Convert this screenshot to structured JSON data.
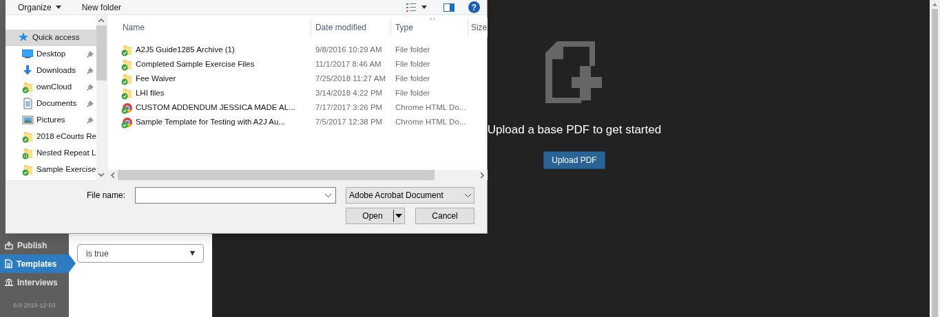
{
  "app": {
    "sidebar": {
      "items": [
        {
          "label": "Publish",
          "kind": "publish",
          "selected": false
        },
        {
          "label": "Templates",
          "kind": "document",
          "selected": true
        },
        {
          "label": "Interviews",
          "kind": "bank",
          "selected": false
        }
      ],
      "version": "6.0 2018-12-03"
    },
    "panel": {
      "select_value": "is true"
    },
    "main": {
      "message": "Upload a base PDF to get started",
      "button": "Upload PDF"
    }
  },
  "dialog": {
    "toolbar": {
      "organize": "Organize",
      "new_folder": "New folder",
      "help": "?"
    },
    "nav": [
      {
        "label": "Quick access",
        "kind": "star",
        "pinned": false,
        "selected": true
      },
      {
        "label": "Desktop",
        "kind": "desktop",
        "pinned": true,
        "selected": false
      },
      {
        "label": "Downloads",
        "kind": "download",
        "pinned": true,
        "selected": false
      },
      {
        "label": "ownCloud",
        "kind": "folder",
        "pinned": true,
        "selected": false
      },
      {
        "label": "Documents",
        "kind": "documents",
        "pinned": true,
        "selected": false
      },
      {
        "label": "Pictures",
        "kind": "pictures",
        "pinned": true,
        "selected": false
      },
      {
        "label": "2018 eCourts Re",
        "kind": "folder",
        "pinned": false,
        "selected": false
      },
      {
        "label": "Nested Repeat L",
        "kind": "shared-folder",
        "pinned": false,
        "selected": false
      },
      {
        "label": "Sample Exercise",
        "kind": "folder",
        "pinned": false,
        "selected": false
      }
    ],
    "columns": [
      "Name",
      "Date modified",
      "Type",
      "Size"
    ],
    "files": [
      {
        "name": "A2J5 Guide1285 Archive (1)",
        "date": "9/8/2016 10:29 AM",
        "type": "File folder",
        "kind": "folder"
      },
      {
        "name": "Completed Sample Exercise Files",
        "date": "11/1/2017 8:46 AM",
        "type": "File folder",
        "kind": "folder"
      },
      {
        "name": "Fee Waiver",
        "date": "7/25/2018 11:27 AM",
        "type": "File folder",
        "kind": "folder"
      },
      {
        "name": "LHI files",
        "date": "3/14/2018 4:22 PM",
        "type": "File folder",
        "kind": "folder"
      },
      {
        "name": "CUSTOM ADDENDUM JESSICA MADE AL...",
        "date": "7/17/2017 3:26 PM",
        "type": "Chrome HTML Do...",
        "kind": "chrome"
      },
      {
        "name": "Sample Template for Testing with A2J Au...",
        "date": "7/5/2017 12:38 PM",
        "type": "Chrome HTML Do...",
        "kind": "chrome"
      }
    ],
    "file_name_label": "File name:",
    "file_type": "Adobe Acrobat Document",
    "open": "Open",
    "cancel": "Cancel"
  }
}
